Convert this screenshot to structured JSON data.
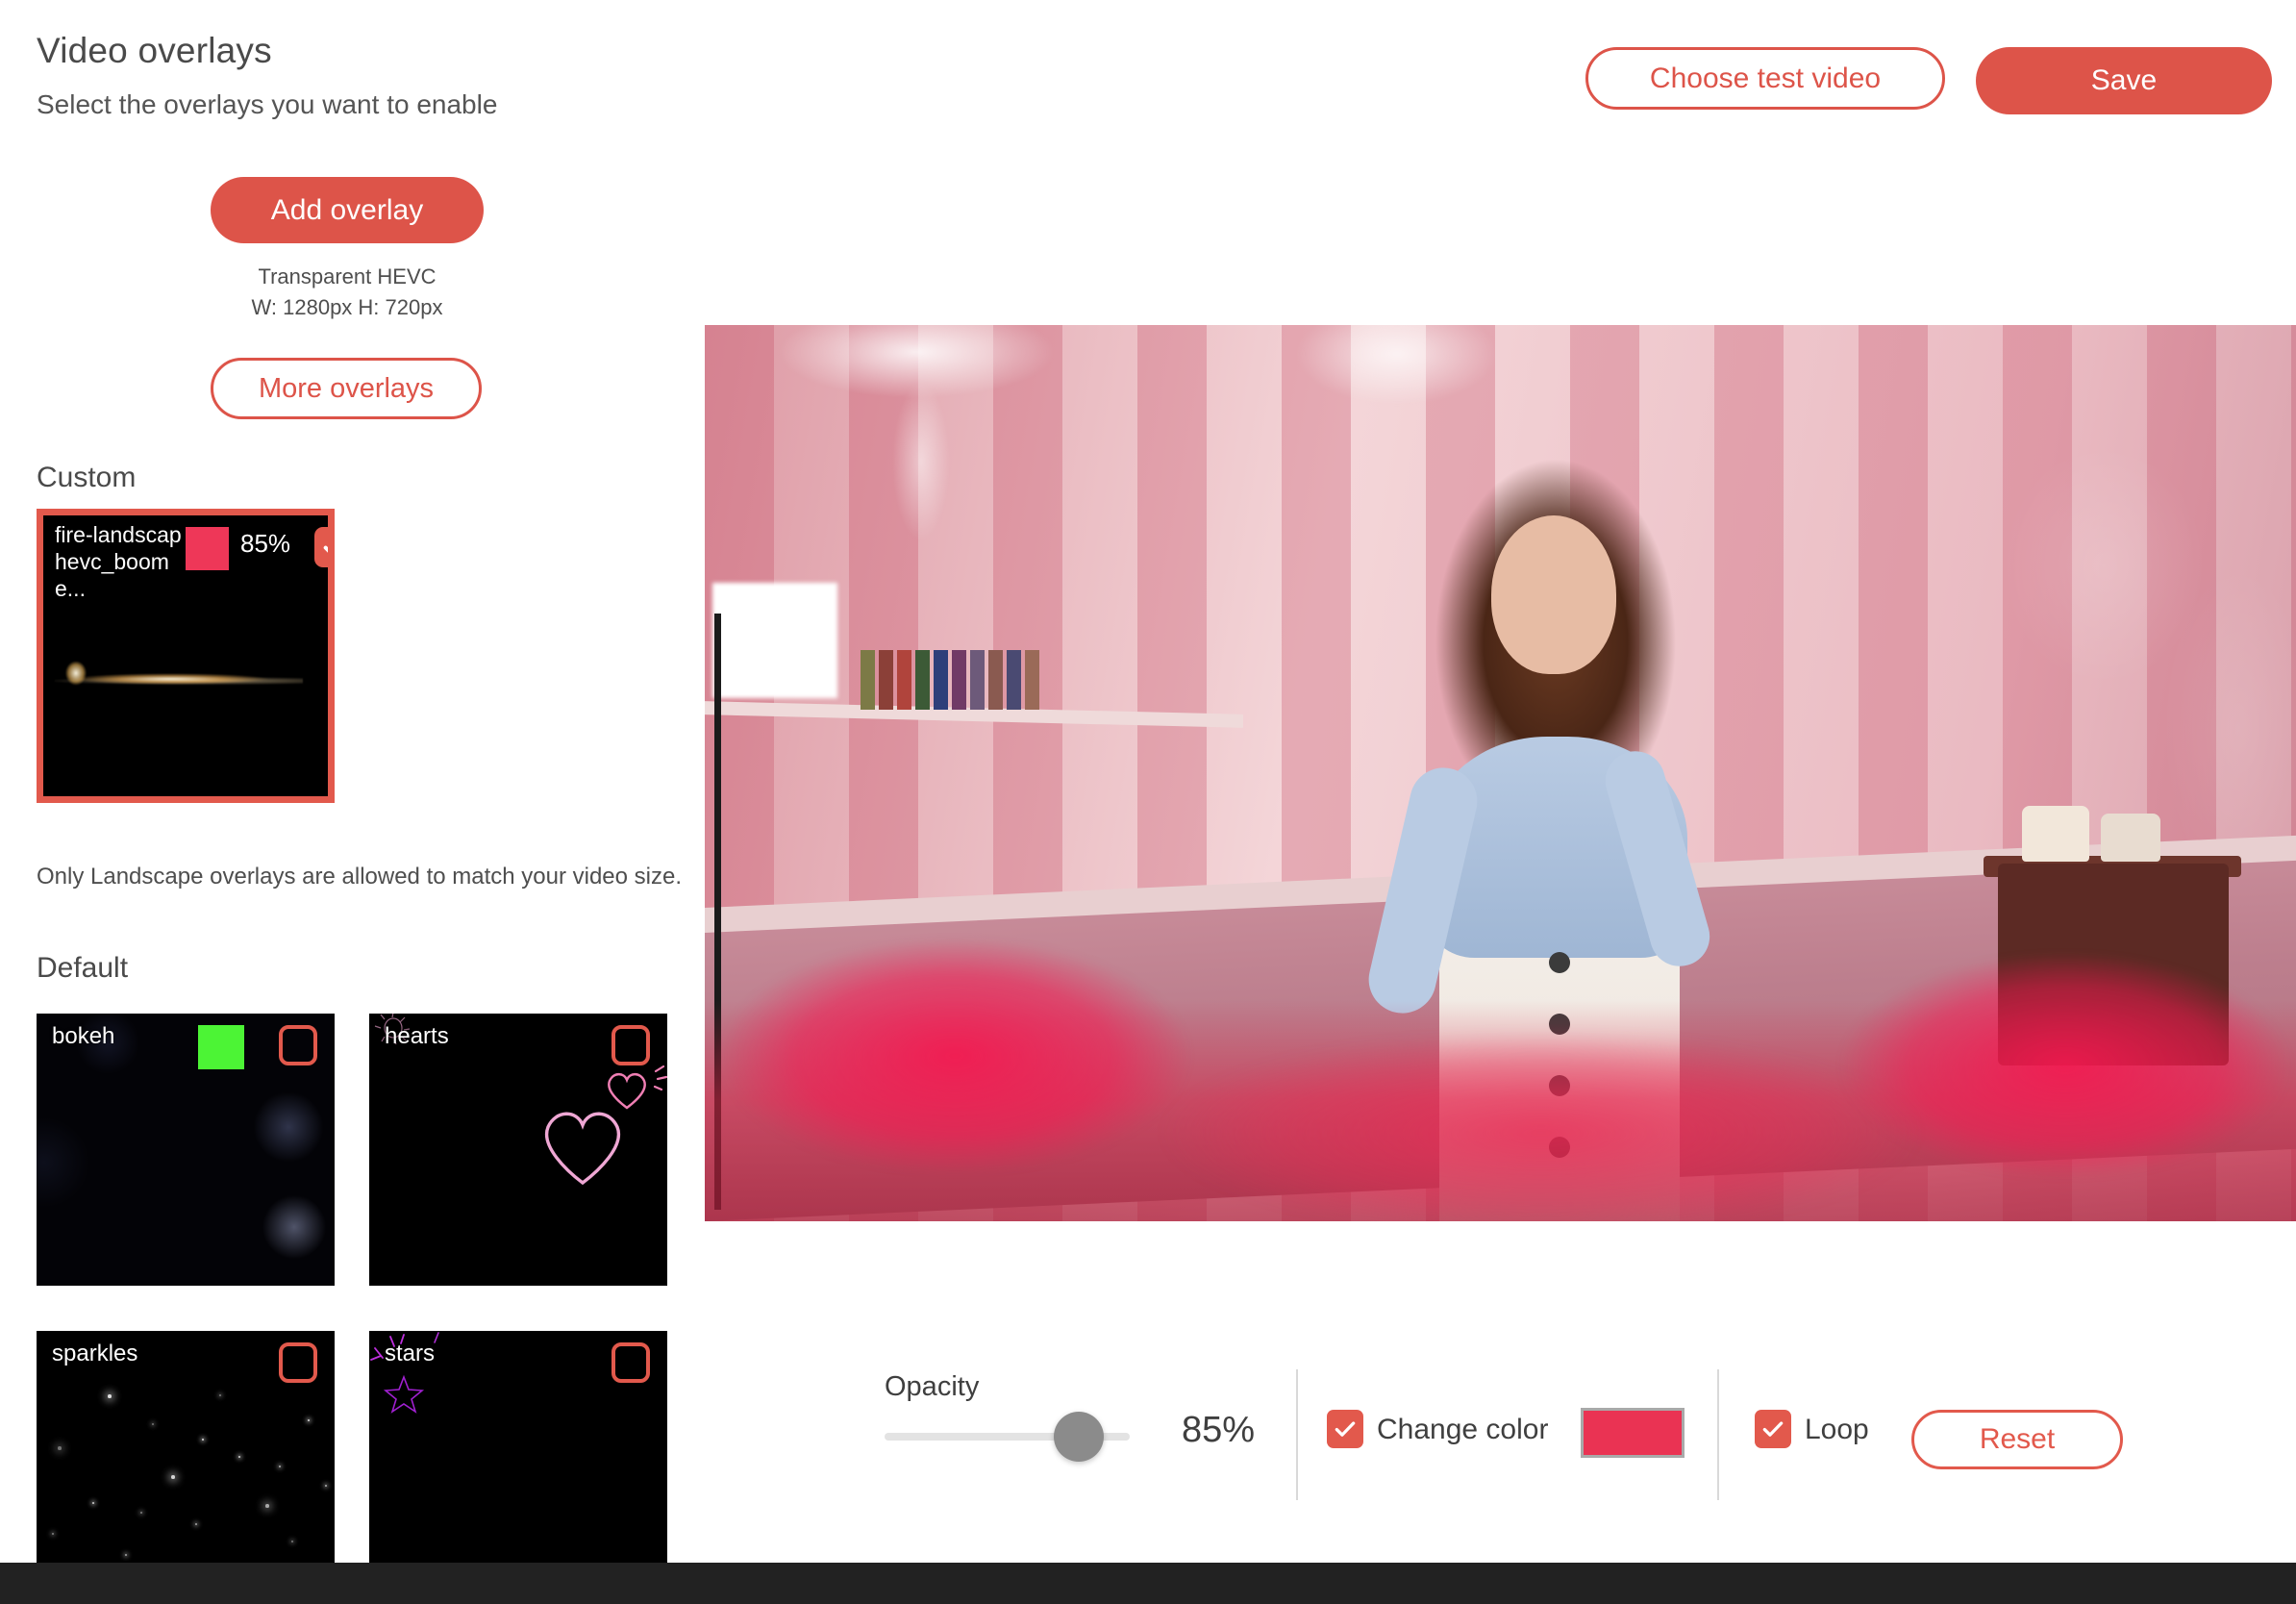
{
  "header": {
    "title": "Video overlays",
    "subtitle": "Select the overlays you want to enable",
    "choose_test_video_label": "Choose test video",
    "save_label": "Save"
  },
  "left_panel": {
    "add_overlay_label": "Add overlay",
    "hevc_info_line1": "Transparent HEVC",
    "hevc_info_line2": "W: 1280px H: 720px",
    "more_overlays_label": "More overlays",
    "custom_section_label": "Custom",
    "landscape_note": "Only Landscape overlays are allowed to match your video size.",
    "default_section_label": "Default"
  },
  "custom_overlay": {
    "name": "fire-landscap hevc_boome...",
    "name_line1": "fire-landscap",
    "name_line2": "hevc_boome...",
    "color": "#ee3758",
    "opacity_label": "85%",
    "checked": true,
    "delete_icon": "trash-icon"
  },
  "default_overlays": [
    {
      "name": "bokeh",
      "checked": false,
      "color": "#4cf435",
      "has_color": true
    },
    {
      "name": "hearts",
      "checked": false,
      "color": "",
      "has_color": false
    },
    {
      "name": "sparkles",
      "checked": false,
      "color": "",
      "has_color": false
    },
    {
      "name": "stars",
      "checked": false,
      "color": "",
      "has_color": false
    }
  ],
  "controls": {
    "opacity_label": "Opacity",
    "opacity_value": "85%",
    "opacity_percent": 85,
    "change_color_label": "Change color",
    "change_color_checked": true,
    "change_color_value": "#ea3353",
    "loop_label": "Loop",
    "loop_checked": true,
    "reset_label": "Reset"
  },
  "theme": {
    "accent": "#dd5449",
    "accent_alt": "#e2594c",
    "pink": "#ea3353",
    "green": "#4cf435",
    "text": "#4a4a4a",
    "bottom_bar": "#222222"
  }
}
